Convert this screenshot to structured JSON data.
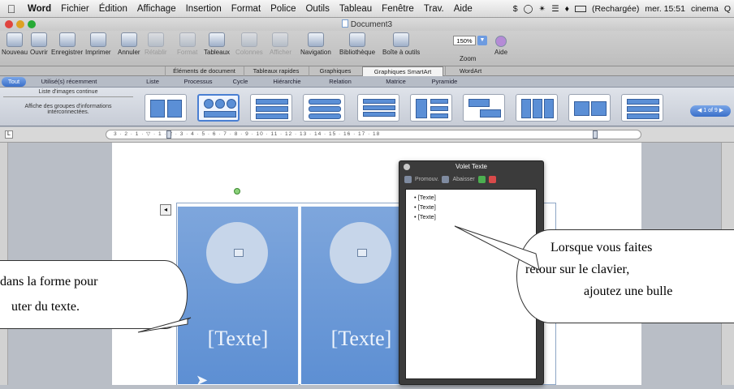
{
  "menubar": {
    "app": "Word",
    "items": [
      "Fichier",
      "Édition",
      "Affichage",
      "Insertion",
      "Format",
      "Police",
      "Outils",
      "Tableau",
      "Fenêtre",
      "Trav.",
      "Aide"
    ],
    "battery": "(Rechargée)",
    "clock": "mer. 15:51",
    "user": "cinema",
    "search_glyph": "Q"
  },
  "window": {
    "title": "Document3"
  },
  "toolbar": {
    "buttons": [
      "Nouveau",
      "Ouvrir",
      "Enregistrer",
      "Imprimer",
      "Annuler",
      "Rétablir",
      "Format",
      "Tableaux",
      "Colonnes",
      "Afficher",
      "Navigation",
      "Bibliothèque",
      "Boîte à outils",
      "Zoom",
      "Aide"
    ],
    "zoom_value": "150%"
  },
  "ribbon_tabs": [
    "Éléments de document",
    "Tableaux rapides",
    "Graphiques",
    "Graphiques SmartArt",
    "WordArt"
  ],
  "smartart_tabs": [
    "Tout",
    "Utilisé(s) récemment",
    "Liste",
    "Processus",
    "Cycle",
    "Hiérarchie",
    "Relation",
    "Matrice",
    "Pyramide"
  ],
  "gallery": {
    "layout_name": "Liste d'images continue",
    "layout_desc": "Affiche des groupes d'informations interconnectées.",
    "pager": "1 of 9"
  },
  "ruler_numbers": "3 · 2 · 1 · ▽ · 1 · 2 · 3 · 4 · 5 · 6 · 7 · 8 · 9 · 10 · 11 · 12 · 13 · 14 · 15 · 16 · 17 · 18",
  "smartart": {
    "panels": [
      "[Texte]",
      "[Texte]"
    ]
  },
  "volet": {
    "title": "Volet Texte",
    "promote": "Promouv.",
    "demote": "Abaisser",
    "items": [
      "[Texte]",
      "[Texte]",
      "[Texte]"
    ]
  },
  "callout_left": {
    "line1": "dans la forme pour",
    "line2": "uter du texte."
  },
  "callout_right": {
    "line1": "Lorsque vous faites",
    "line2": "retour sur le clavier,",
    "line3": "ajoutez une bulle"
  },
  "colors": {
    "panel": "#6a96d6",
    "accent": "#3a6fc9",
    "volet_bg": "#3b3b3b"
  }
}
